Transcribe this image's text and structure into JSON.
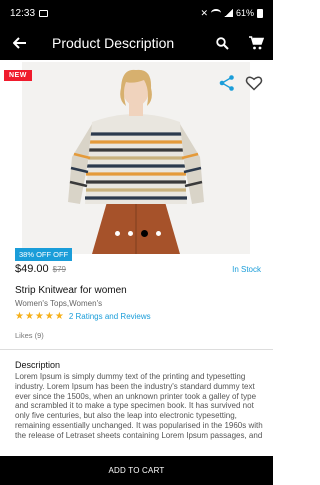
{
  "status_bar": {
    "time": "12:33",
    "battery_text": "61%"
  },
  "app_bar": {
    "title": "Product Description",
    "icons": [
      "back-arrow-icon",
      "search-icon",
      "cart-icon"
    ]
  },
  "product": {
    "badge": "NEW",
    "discount": "38% OFF OFF",
    "price": "$49.00",
    "old_price": "$79",
    "stock": "In Stock",
    "name": "Strip Knitwear for women",
    "category": "Women's Tops,Women's",
    "rating_stars": 5,
    "stars_text": "★★★★★",
    "ratings_text": "2  Ratings and Reviews",
    "likes": "Likes (9)",
    "image_count": 4,
    "active_image_index": 2
  },
  "description": {
    "title": "Description",
    "body": "Lorem Ipsum is simply dummy text of the printing and typesetting industry. Lorem Ipsum has been the industry's standard dummy text ever since the 1500s, when an unknown printer took a galley of type and scrambled it to make a type specimen book. It has survived not only five centuries, but also the leap into electronic typesetting, remaining essentially unchanged. It was popularised in the 1960s with the release of Letraset sheets containing Lorem Ipsum passages, and"
  },
  "actions": {
    "add_to_cart": "ADD TO CART"
  },
  "colors": {
    "bar": "#000000",
    "new_badge": "#f01b2d",
    "accent": "#1a9dd9",
    "star": "#f6b01a"
  }
}
